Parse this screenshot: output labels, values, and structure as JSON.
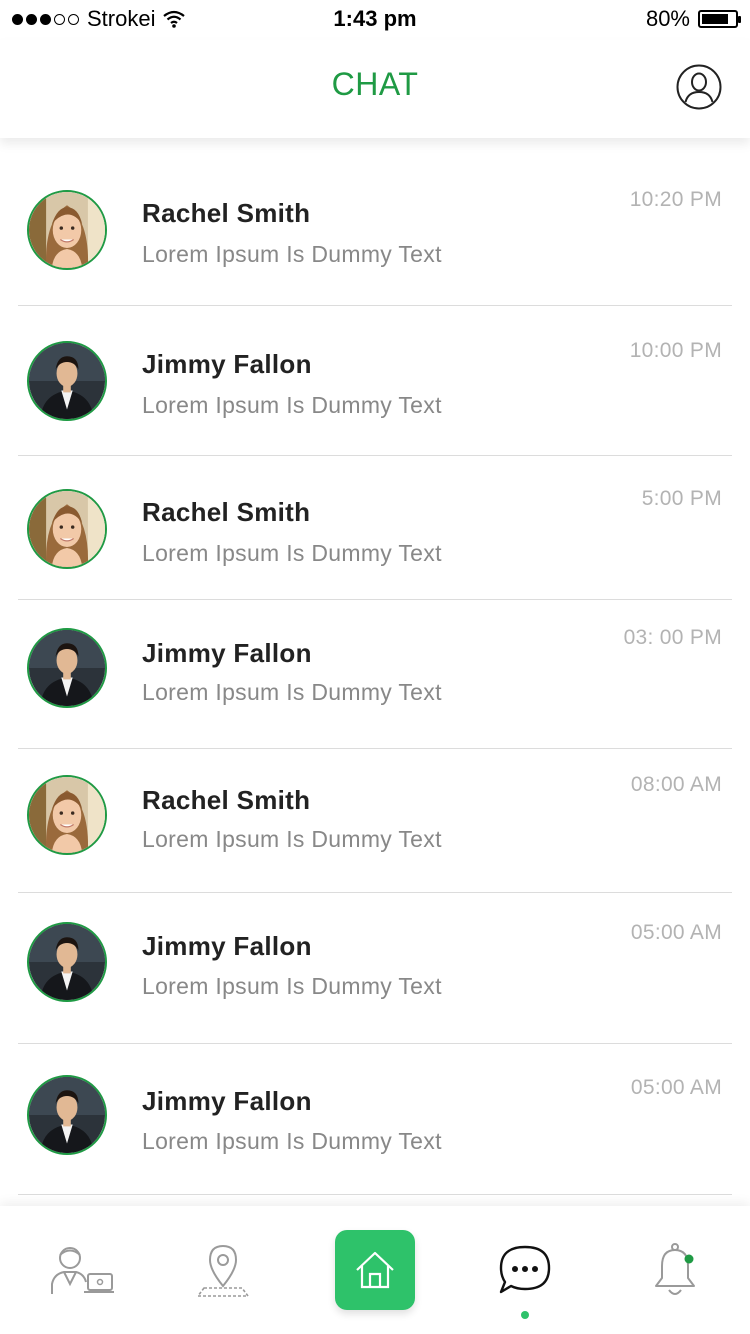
{
  "status": {
    "carrier": "Strokei",
    "time": "1:43 pm",
    "battery": "80%",
    "battery_level": 0.8
  },
  "header": {
    "title": "CHAT",
    "profile_icon": "user-circle-icon"
  },
  "chats": [
    {
      "name": "Rachel Smith",
      "message": "Lorem Ipsum Is Dummy Text",
      "time": "10:20 PM",
      "avatar": "woman"
    },
    {
      "name": "Jimmy Fallon",
      "message": "Lorem Ipsum Is Dummy Text",
      "time": "10:00 PM",
      "avatar": "man"
    },
    {
      "name": "Rachel Smith",
      "message": "Lorem Ipsum Is Dummy Text",
      "time": "5:00 PM",
      "avatar": "woman"
    },
    {
      "name": "Jimmy Fallon",
      "message": "Lorem Ipsum Is Dummy Text",
      "time": "03: 00 PM",
      "avatar": "man"
    },
    {
      "name": "Rachel Smith",
      "message": "Lorem Ipsum Is Dummy Text",
      "time": "08:00 AM",
      "avatar": "woman"
    },
    {
      "name": "Jimmy Fallon",
      "message": "Lorem Ipsum Is Dummy Text",
      "time": "05:00 AM",
      "avatar": "man"
    },
    {
      "name": "Jimmy Fallon",
      "message": "Lorem Ipsum Is Dummy Text",
      "time": "05:00 AM",
      "avatar": "man"
    }
  ],
  "tabbar": {
    "items": [
      "profile-laptop-icon",
      "location-pin-icon",
      "home-icon",
      "chat-bubble-icon",
      "bell-icon"
    ],
    "active": "chat-bubble-icon"
  },
  "colors": {
    "accent": "#1f9a44",
    "home_button": "#2ec26a"
  }
}
